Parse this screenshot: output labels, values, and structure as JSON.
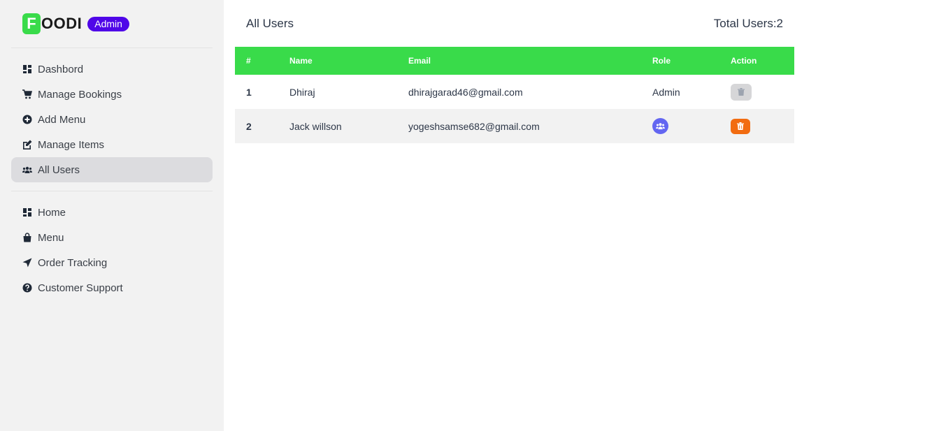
{
  "brand": {
    "logo_letter": "F",
    "logo_rest": "OODI",
    "badge": "Admin",
    "logo_color": "#39db4a",
    "badge_color": "#4f06e8"
  },
  "sidebar": {
    "admin_items": [
      {
        "label": "Dashbord",
        "icon": "dashboard-icon"
      },
      {
        "label": "Manage Bookings",
        "icon": "cart-icon"
      },
      {
        "label": "Add Menu",
        "icon": "plus-circle-icon"
      },
      {
        "label": "Manage Items",
        "icon": "edit-icon"
      },
      {
        "label": "All Users",
        "icon": "users-icon",
        "active": true
      }
    ],
    "site_items": [
      {
        "label": "Home",
        "icon": "dashboard-icon"
      },
      {
        "label": "Menu",
        "icon": "shopping-bag-icon"
      },
      {
        "label": "Order Tracking",
        "icon": "location-arrow-icon"
      },
      {
        "label": "Customer Support",
        "icon": "question-circle-icon"
      }
    ]
  },
  "page": {
    "title": "All Users",
    "total_label": "Total Users:2"
  },
  "table": {
    "headers": [
      "#",
      "Name",
      "Email",
      "Role",
      "Action"
    ],
    "header_color": "#39db4a",
    "rows": [
      {
        "index": "1",
        "name": "Dhiraj",
        "email": "dhirajgarad46@gmail.com",
        "role": "Admin",
        "role_display": "text",
        "action": "delete-disabled"
      },
      {
        "index": "2",
        "name": "Jack willson",
        "email": "yogeshsamse682@gmail.com",
        "role": "",
        "role_display": "users-icon-button",
        "action": "delete"
      }
    ]
  },
  "colors": {
    "delete_button": "#f26c11",
    "role_button": "#6366f1",
    "disabled_button": "#d6d6d8"
  }
}
